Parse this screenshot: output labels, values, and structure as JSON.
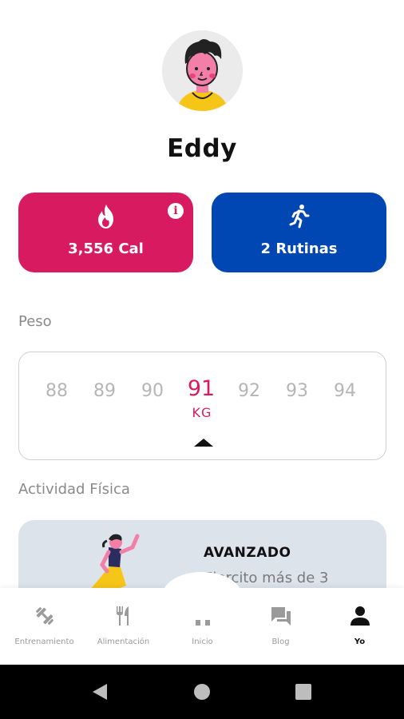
{
  "profile": {
    "name": "Eddy",
    "avatar_icon": "cartoon-boy-avatar"
  },
  "stats": {
    "calories": {
      "value": "3,556 Cal",
      "icon": "flame-icon",
      "color": "#d81b60",
      "info_glyph": "i"
    },
    "routines": {
      "value": "2 Rutinas",
      "icon": "running-person-icon",
      "color": "#0047b3"
    }
  },
  "weight": {
    "label": "Peso",
    "options": [
      "88",
      "89",
      "90",
      "91",
      "92",
      "93",
      "94"
    ],
    "selected": "91",
    "unit": "KG"
  },
  "activity": {
    "label": "Actividad Física",
    "level": "AVANZADO",
    "description": "Ejercito más de 3"
  },
  "nav": {
    "items": [
      {
        "label": "Entrenamiento",
        "icon": "dumbbell-icon"
      },
      {
        "label": "Alimentación",
        "icon": "fork-knife-icon"
      },
      {
        "label": "Inicio",
        "icon": "home-icon"
      },
      {
        "label": "Blog",
        "icon": "chat-icon"
      },
      {
        "label": "Yo",
        "icon": "person-icon",
        "active": true
      }
    ]
  },
  "colors": {
    "accent": "#d81b60",
    "primary": "#0047b3",
    "inactive": "#9a9a9a"
  }
}
